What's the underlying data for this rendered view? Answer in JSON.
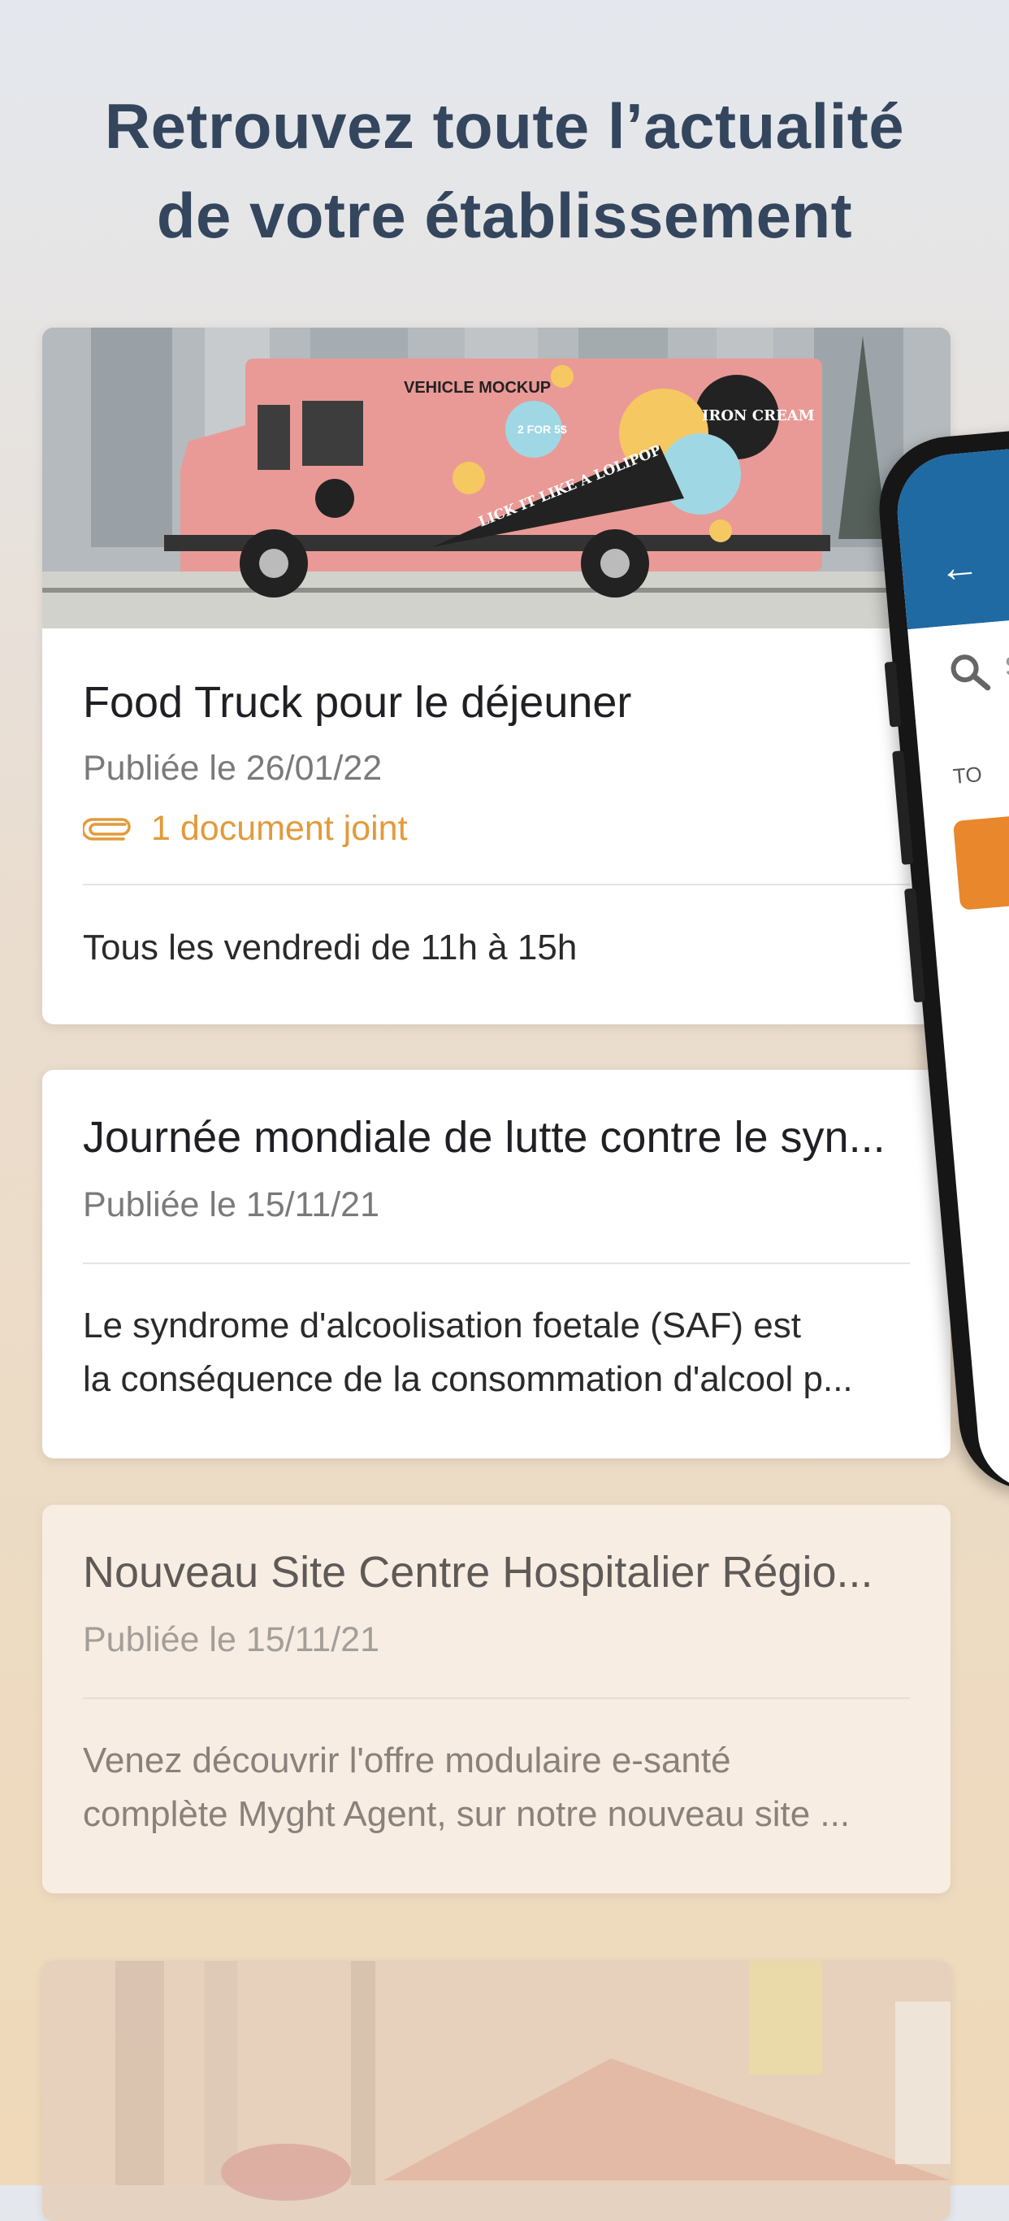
{
  "headline": {
    "line1": "Retrouvez toute l’actualité",
    "line2": "de votre établissement"
  },
  "news": [
    {
      "title": "Food Truck pour le déjeuner",
      "date": "Publiée le 26/01/22",
      "attachment": "1 document joint",
      "text_lines": [
        "Tous les vendredi de 11h à 15h"
      ],
      "image_text": {
        "vehicle_mockup": "VEHICLE MOCKUP",
        "promo": "2 FOR 5$",
        "brand": "IRON CREAM",
        "slogan": "LICK IT LIKE A LOLIPOP"
      }
    },
    {
      "title": "Journée mondiale de lutte contre le syn...",
      "date": "Publiée le 15/11/21",
      "text_lines": [
        "Le syndrome d'alcoolisation foetale (SAF) est",
        "la conséquence de la consommation d'alcool p..."
      ]
    },
    {
      "title": "Nouveau Site Centre Hospitalier Régio...",
      "date": "Publiée le 15/11/21",
      "text_lines": [
        "Venez découvrir l'offre modulaire e-santé",
        "complète Myght Agent, sur notre nouveau site ..."
      ]
    }
  ],
  "phone": {
    "search_placeholder": "S",
    "tab_fragment": "TO",
    "back_icon": "arrow-left-icon"
  },
  "colors": {
    "headline": "#34465e",
    "accent_orange": "#e39a3b",
    "phone_appbar": "#1f6aa3"
  }
}
